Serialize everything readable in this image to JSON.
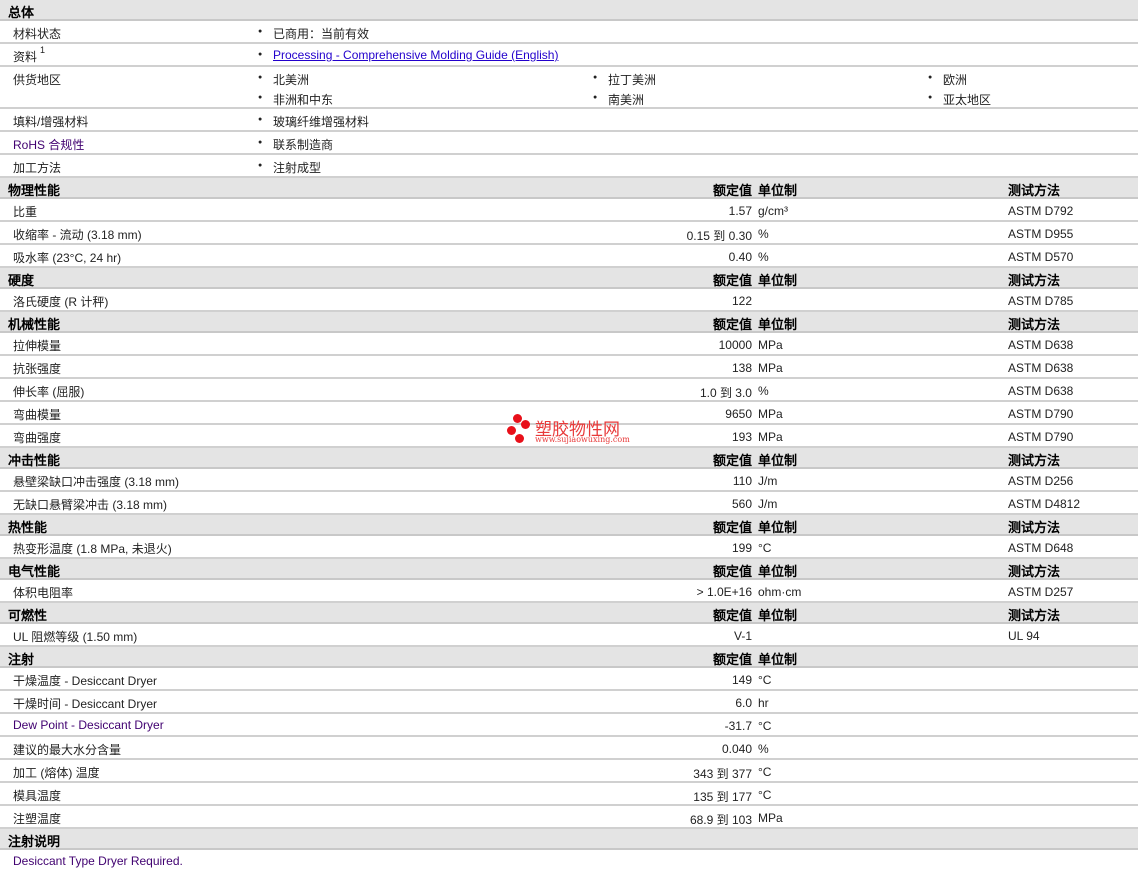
{
  "general": {
    "title": "总体",
    "rows": [
      {
        "label": "材料状态",
        "values": [
          "已商用：当前有效"
        ]
      },
      {
        "label": "资料",
        "sup": "1",
        "link": "Processing - Comprehensive Molding Guide (English)"
      },
      {
        "label": "供货地区",
        "regions": [
          "北美洲",
          "拉丁美洲",
          "欧洲",
          "非洲和中东",
          "南美洲",
          "亚太地区"
        ]
      },
      {
        "label": "填料/增强材料",
        "values": [
          "玻璃纤维增强材料"
        ]
      },
      {
        "label": "RoHS 合规性",
        "values": [
          "联系制造商"
        ]
      },
      {
        "label": "加工方法",
        "values": [
          "注射成型"
        ]
      }
    ]
  },
  "headers": {
    "value": "额定值",
    "unit": "单位制",
    "method": "测试方法"
  },
  "sections": [
    {
      "title": "物理性能",
      "show_method": true,
      "rows": [
        {
          "label": "比重",
          "value": "1.57",
          "unit": "g/cm³",
          "method": "ASTM D792"
        },
        {
          "label": "收缩率 - 流动 (3.18 mm)",
          "value": "0.15 到  0.30",
          "unit": "%",
          "method": "ASTM D955"
        },
        {
          "label": "吸水率 (23°C, 24 hr)",
          "value": "0.40",
          "unit": "%",
          "method": "ASTM D570"
        }
      ]
    },
    {
      "title": "硬度",
      "show_method": true,
      "rows": [
        {
          "label": "洛氏硬度 (R 计秤)",
          "value": "122",
          "unit": "",
          "method": "ASTM D785"
        }
      ]
    },
    {
      "title": "机械性能",
      "show_method": true,
      "rows": [
        {
          "label": "拉伸模量",
          "value": "10000",
          "unit": "MPa",
          "method": "ASTM D638"
        },
        {
          "label": "抗张强度",
          "value": "138",
          "unit": "MPa",
          "method": "ASTM D638"
        },
        {
          "label": "伸长率 (屈服)",
          "value": "1.0 到  3.0",
          "unit": "%",
          "method": "ASTM D638"
        },
        {
          "label": "弯曲模量",
          "value": "9650",
          "unit": "MPa",
          "method": "ASTM D790"
        },
        {
          "label": "弯曲强度",
          "value": "193",
          "unit": "MPa",
          "method": "ASTM D790"
        }
      ]
    },
    {
      "title": "冲击性能",
      "show_method": true,
      "rows": [
        {
          "label": "悬壁梁缺口冲击强度 (3.18 mm)",
          "value": "110",
          "unit": "J/m",
          "method": "ASTM D256"
        },
        {
          "label": "无缺口悬臂梁冲击 (3.18 mm)",
          "value": "560",
          "unit": "J/m",
          "method": "ASTM D4812"
        }
      ]
    },
    {
      "title": "热性能",
      "show_method": true,
      "rows": [
        {
          "label": "热变形温度 (1.8 MPa, 未退火)",
          "value": "199",
          "unit": "°C",
          "method": "ASTM D648"
        }
      ]
    },
    {
      "title": "电气性能",
      "show_method": true,
      "rows": [
        {
          "label": "体积电阻率",
          "value": "> 1.0E+16",
          "unit": "ohm·cm",
          "method": "ASTM D257"
        }
      ]
    },
    {
      "title": "可燃性",
      "show_method": true,
      "rows": [
        {
          "label": "UL 阻燃等级 (1.50 mm)",
          "value": "V-1",
          "unit": "",
          "method": "UL 94"
        }
      ]
    },
    {
      "title": "注射",
      "show_method": false,
      "rows": [
        {
          "label": "干燥温度 - Desiccant Dryer",
          "value": "149",
          "unit": "°C"
        },
        {
          "label": "干燥时间 - Desiccant Dryer",
          "value": "6.0",
          "unit": "hr"
        },
        {
          "label": "Dew Point - Desiccant Dryer",
          "value": "-31.7",
          "unit": "°C",
          "link": true
        },
        {
          "label": "建议的最大水分含量",
          "value": "0.040",
          "unit": "%"
        },
        {
          "label": "加工 (熔体) 温度",
          "value": "343 到  377",
          "unit": "°C"
        },
        {
          "label": "模具温度",
          "value": "135 到  177",
          "unit": "°C"
        },
        {
          "label": "注塑温度",
          "value": "68.9 到  103",
          "unit": "MPa"
        }
      ]
    }
  ],
  "notes": {
    "title": "注射说明",
    "text": "Desiccant Type Dryer Required."
  },
  "watermark": {
    "name": "塑胶物性网",
    "url": "www.sujiaowuxing.com"
  }
}
